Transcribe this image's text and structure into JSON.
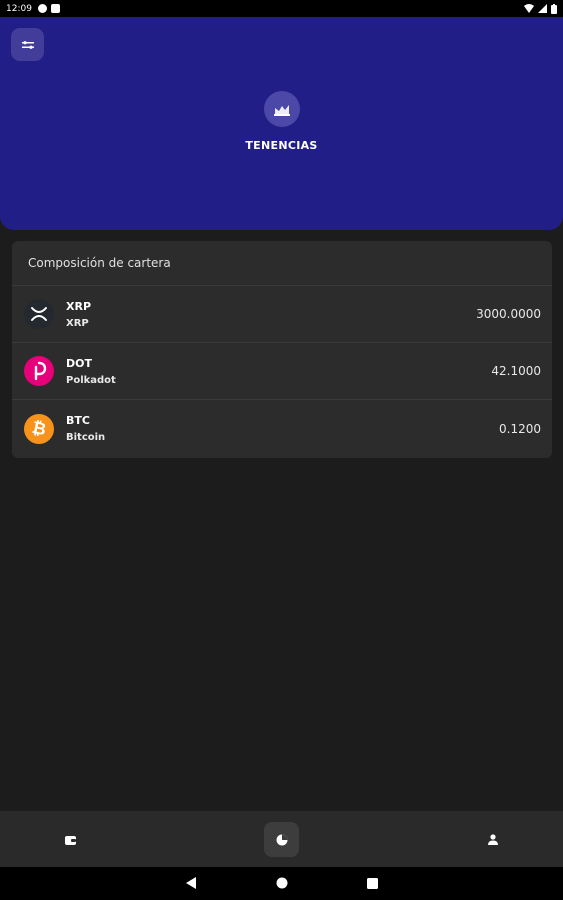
{
  "status_bar": {
    "time": "12:09"
  },
  "header": {
    "title": "TENENCIAS",
    "accent": "#221e87"
  },
  "portfolio": {
    "title": "Composición de cartera",
    "items": [
      {
        "symbol": "XRP",
        "name": "XRP",
        "amount": "3000.0000",
        "icon": "xrp-icon",
        "color": "#23292f"
      },
      {
        "symbol": "DOT",
        "name": "Polkadot",
        "amount": "42.1000",
        "icon": "polkadot-icon",
        "color": "#e6007a"
      },
      {
        "symbol": "BTC",
        "name": "Bitcoin",
        "amount": "0.1200",
        "icon": "bitcoin-icon",
        "color": "#f7931a"
      }
    ]
  },
  "bottom_nav": {
    "items": [
      {
        "icon": "wallet-icon"
      },
      {
        "icon": "pie-chart-icon",
        "active": true
      },
      {
        "icon": "user-icon"
      }
    ]
  },
  "system_nav": {
    "items": [
      {
        "icon": "back-icon"
      },
      {
        "icon": "home-icon"
      },
      {
        "icon": "recents-icon"
      }
    ]
  }
}
